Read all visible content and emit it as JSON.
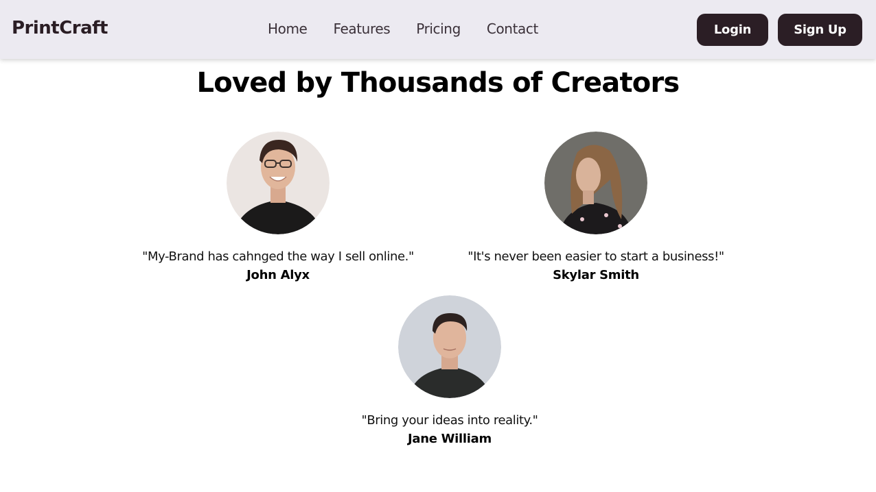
{
  "brand": "PrintCraft",
  "nav": {
    "links": [
      "Home",
      "Features",
      "Pricing",
      "Contact"
    ],
    "login_label": "Login",
    "signup_label": "Sign Up"
  },
  "section": {
    "heading": "Loved by Thousands of Creators"
  },
  "testimonials": [
    {
      "quote": "\"My-Brand has cahnged the way I sell online.\"",
      "author": "John Alyx",
      "avatar": "avatar-man-glasses"
    },
    {
      "quote": "\"It's never been easier to start a business!\"",
      "author": "Skylar Smith",
      "avatar": "avatar-woman-long-hair"
    },
    {
      "quote": "\"Bring your ideas into reality.\"",
      "author": "Jane William",
      "avatar": "avatar-man-dark-shirt"
    }
  ],
  "colors": {
    "navbar_bg": "#eceaf1",
    "button_bg": "#2b1e25",
    "button_text": "#ffffff"
  }
}
